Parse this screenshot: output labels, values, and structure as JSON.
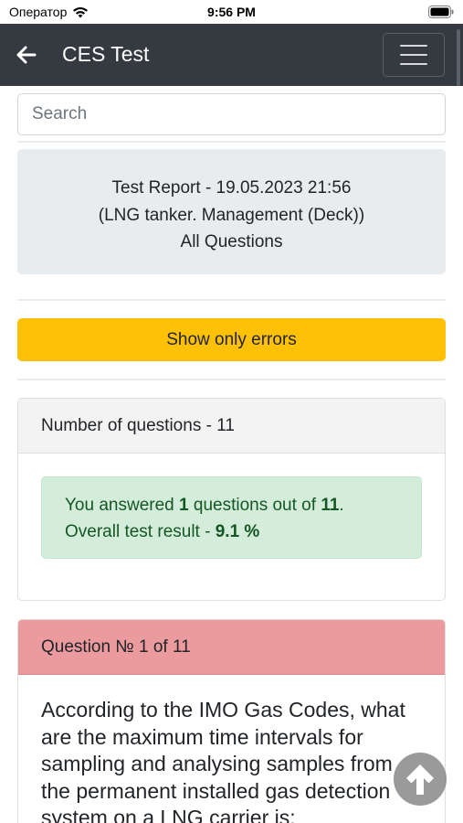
{
  "status_bar": {
    "carrier": "Оператор",
    "time": "9:56 PM"
  },
  "navbar": {
    "title": "CES Test",
    "back_icon": "arrow-left-icon",
    "menu_icon": "hamburger-menu-icon"
  },
  "search": {
    "placeholder": "Search",
    "value": ""
  },
  "report": {
    "line1": "Test Report - 19.05.2023 21:56",
    "line2": "(LNG tanker. Management (Deck))",
    "line3": "All Questions"
  },
  "errors_button": {
    "label": "Show only errors"
  },
  "summary": {
    "header": "Number of questions - 11",
    "answered_prefix": "You answered ",
    "answered_count": "1",
    "answered_middle": " questions out of ",
    "total_count": "11",
    "answered_suffix": ".",
    "result_prefix": "Overall test result - ",
    "result_value": "9.1 %"
  },
  "question": {
    "header": "Question № 1 of 11",
    "text": "According to the IMO Gas Codes, what are the maximum time intervals for sampling and analysing samples from the permanent installed gas detection system on a LNG carrier is:"
  },
  "colors": {
    "navbar_bg": "#343a40",
    "warning": "#ffc107",
    "success_bg": "#d4edda",
    "success_text": "#155724",
    "danger_header": "#eb9a9e",
    "report_bg": "#e9ecef"
  },
  "icons": {
    "scroll_top": "arrow-up-icon",
    "wifi": "wifi-icon",
    "battery": "battery-icon"
  }
}
